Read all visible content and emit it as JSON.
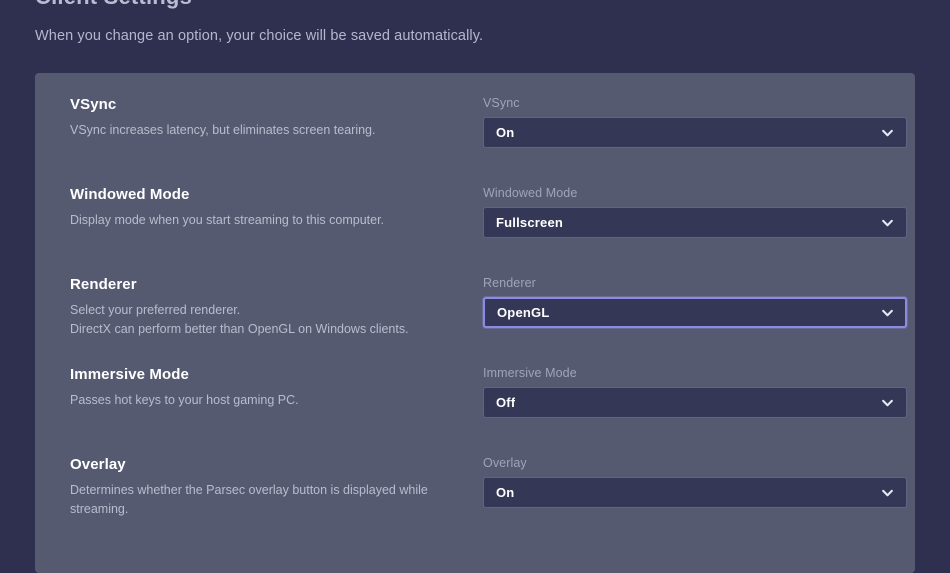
{
  "header": {
    "title": "Client Settings",
    "subtitle": "When you change an option, your choice will be saved automatically."
  },
  "colors": {
    "page_background": "#2f3050",
    "panel_background": "#565a70",
    "select_background": "#343756",
    "select_border": "#5f6484",
    "focus_border": "#8b8ce0",
    "heading_text": "#ffffff",
    "muted_text": "#b9bcce"
  },
  "icons": {
    "chevron": "chevron-down-icon"
  },
  "settings": [
    {
      "id": "vsync",
      "name": "VSync",
      "desc_lines": [
        "VSync increases latency, but eliminates screen tearing."
      ],
      "control_label": "VSync",
      "value": "On",
      "focused": false
    },
    {
      "id": "windowed-mode",
      "name": "Windowed Mode",
      "desc_lines": [
        "Display mode when you start streaming to this computer."
      ],
      "control_label": "Windowed Mode",
      "value": "Fullscreen",
      "focused": false
    },
    {
      "id": "renderer",
      "name": "Renderer",
      "desc_lines": [
        "Select your preferred renderer.",
        "DirectX can perform better than OpenGL on Windows clients."
      ],
      "control_label": "Renderer",
      "value": "OpenGL",
      "focused": true
    },
    {
      "id": "immersive-mode",
      "name": "Immersive Mode",
      "desc_lines": [
        "Passes hot keys to your host gaming PC."
      ],
      "control_label": "Immersive Mode",
      "value": "Off",
      "focused": false
    },
    {
      "id": "overlay",
      "name": "Overlay",
      "desc_lines": [
        "Determines whether the Parsec overlay button is displayed while",
        "streaming."
      ],
      "control_label": "Overlay",
      "value": "On",
      "focused": false
    }
  ]
}
